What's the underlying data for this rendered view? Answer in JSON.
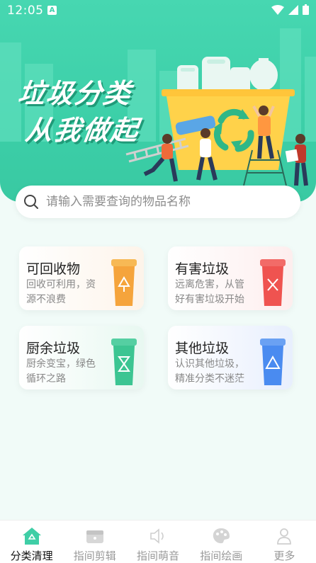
{
  "status_bar": {
    "time": "12:05"
  },
  "hero": {
    "slogan_line1": "垃圾分类",
    "slogan_line2": "从我做起"
  },
  "search": {
    "placeholder": "请输入需要查询的物品名称",
    "value": ""
  },
  "categories": [
    {
      "title": "可回收物",
      "desc": "回收可利用，资源不浪费",
      "color": "#f5a43c"
    },
    {
      "title": "有害垃圾",
      "desc": "远离危害，从管好有害垃圾开始",
      "color": "#ef5350"
    },
    {
      "title": "厨余垃圾",
      "desc": "厨余变宝，绿色循环之路",
      "color": "#3cc592"
    },
    {
      "title": "其他垃圾",
      "desc": "认识其他垃圾，精准分类不迷茫",
      "color": "#4a8bf0"
    }
  ],
  "tabs": [
    {
      "label": "分类清理",
      "icon": "home-recycle-icon",
      "active": true
    },
    {
      "label": "指间剪辑",
      "icon": "clapper-icon",
      "active": false
    },
    {
      "label": "指间萌音",
      "icon": "speaker-icon",
      "active": false
    },
    {
      "label": "指间绘画",
      "icon": "palette-icon",
      "active": false
    },
    {
      "label": "更多",
      "icon": "person-icon",
      "active": false
    }
  ],
  "colors": {
    "brand": "#42d4ad",
    "active_tab": "#3fcea6"
  }
}
